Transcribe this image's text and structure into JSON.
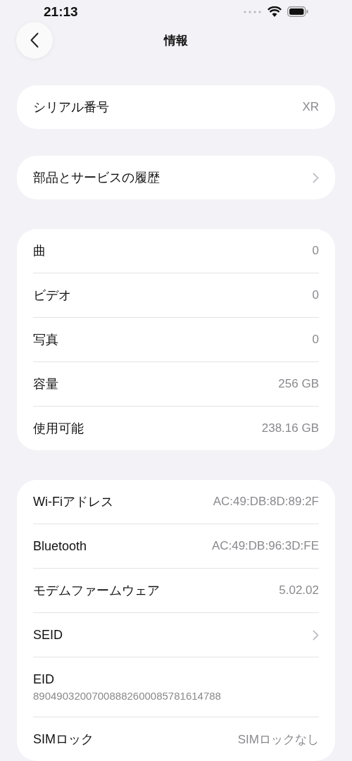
{
  "status_bar": {
    "time": "21:13"
  },
  "nav": {
    "title": "情報"
  },
  "sections": [
    {
      "rows": [
        {
          "kind": "value",
          "label": "シリアル番号",
          "value": "XR"
        }
      ]
    },
    {
      "rows": [
        {
          "kind": "chevron",
          "label": "部品とサービスの履歴"
        }
      ]
    },
    {
      "rows": [
        {
          "kind": "value",
          "label": "曲",
          "value": "0"
        },
        {
          "kind": "value",
          "label": "ビデオ",
          "value": "0"
        },
        {
          "kind": "value",
          "label": "写真",
          "value": "0"
        },
        {
          "kind": "value",
          "label": "容量",
          "value": "256 GB"
        },
        {
          "kind": "value",
          "label": "使用可能",
          "value": "238.16 GB"
        }
      ]
    },
    {
      "rows": [
        {
          "kind": "value",
          "label": "Wi-Fiアドレス",
          "value": "AC:49:DB:8D:89:2F"
        },
        {
          "kind": "value",
          "label": "Bluetooth",
          "value": "AC:49:DB:96:3D:FE"
        },
        {
          "kind": "value",
          "label": "モデムファームウェア",
          "value": "5.02.02"
        },
        {
          "kind": "chevron",
          "label": "SEID"
        },
        {
          "kind": "stacked",
          "label": "EID",
          "value": "89049032007008882600085781614788"
        },
        {
          "kind": "value",
          "label": "SIMロック",
          "value": "SIMロックなし"
        }
      ]
    }
  ]
}
